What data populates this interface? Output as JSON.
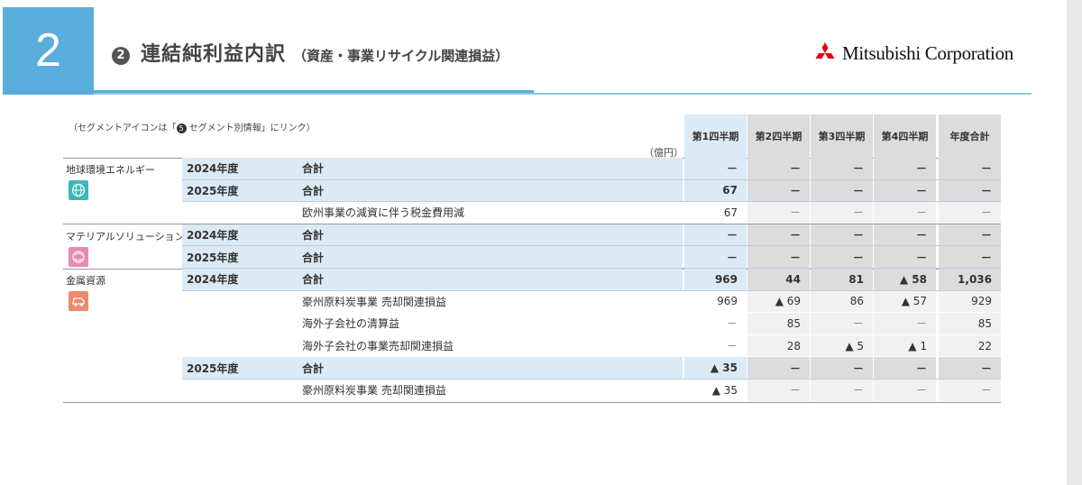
{
  "header": {
    "section_number": "2",
    "title_marker": "2",
    "title": "連結純利益内訳",
    "subtitle": "（資産・事業リサイクル関連損益）",
    "company": "Mitsubishi Corporation"
  },
  "note": {
    "prefix": "（セグメントアイコンは「",
    "marker": "5",
    "suffix": " セグメント別情報」にリンク）"
  },
  "unit": "（億円）",
  "columns": [
    "第1四半期",
    "第2四半期",
    "第3四半期",
    "第4四半期",
    "年度合計"
  ],
  "colors": {
    "accent": "#5aaedc",
    "icon_energy": "#3fb6b8",
    "icon_materials": "#e68bb1",
    "icon_metals": "#ea8a6e"
  },
  "segments": [
    {
      "name": "地球環境エネルギー",
      "icon": "globe-icon",
      "rows": [
        {
          "year": "2024年度",
          "item": "合計",
          "values": [
            "－",
            "－",
            "－",
            "－",
            "－"
          ]
        },
        {
          "year": "2025年度",
          "item": "合計",
          "values": [
            "67",
            "－",
            "－",
            "－",
            "－"
          ]
        },
        {
          "year": "",
          "item": "欧州事業の減資に伴う税金費用減",
          "values": [
            "67",
            "－",
            "－",
            "－",
            "－"
          ]
        }
      ]
    },
    {
      "name": "マテリアルソリューション",
      "icon": "materials-icon",
      "rows": [
        {
          "year": "2024年度",
          "item": "合計",
          "values": [
            "－",
            "－",
            "－",
            "－",
            "－"
          ]
        },
        {
          "year": "2025年度",
          "item": "合計",
          "values": [
            "－",
            "－",
            "－",
            "－",
            "－"
          ]
        }
      ]
    },
    {
      "name": "金属資源",
      "icon": "mining-truck-icon",
      "rows": [
        {
          "year": "2024年度",
          "item": "合計",
          "values": [
            "969",
            "44",
            "81",
            "▲ 58",
            "1,036"
          ]
        },
        {
          "year": "",
          "item": "豪州原料炭事業 売却関連損益",
          "values": [
            "969",
            "▲ 69",
            "86",
            "▲ 57",
            "929"
          ]
        },
        {
          "year": "",
          "item": "海外子会社の清算益",
          "values": [
            "－",
            "85",
            "－",
            "－",
            "85"
          ]
        },
        {
          "year": "",
          "item": "海外子会社の事業売却関連損益",
          "values": [
            "－",
            "28",
            "▲ 5",
            "▲ 1",
            "22"
          ]
        },
        {
          "year": "2025年度",
          "item": "合計",
          "values": [
            "▲ 35",
            "－",
            "－",
            "－",
            "－"
          ]
        },
        {
          "year": "",
          "item": "豪州原料炭事業 売却関連損益",
          "values": [
            "▲ 35",
            "－",
            "－",
            "－",
            "－"
          ]
        }
      ]
    }
  ]
}
